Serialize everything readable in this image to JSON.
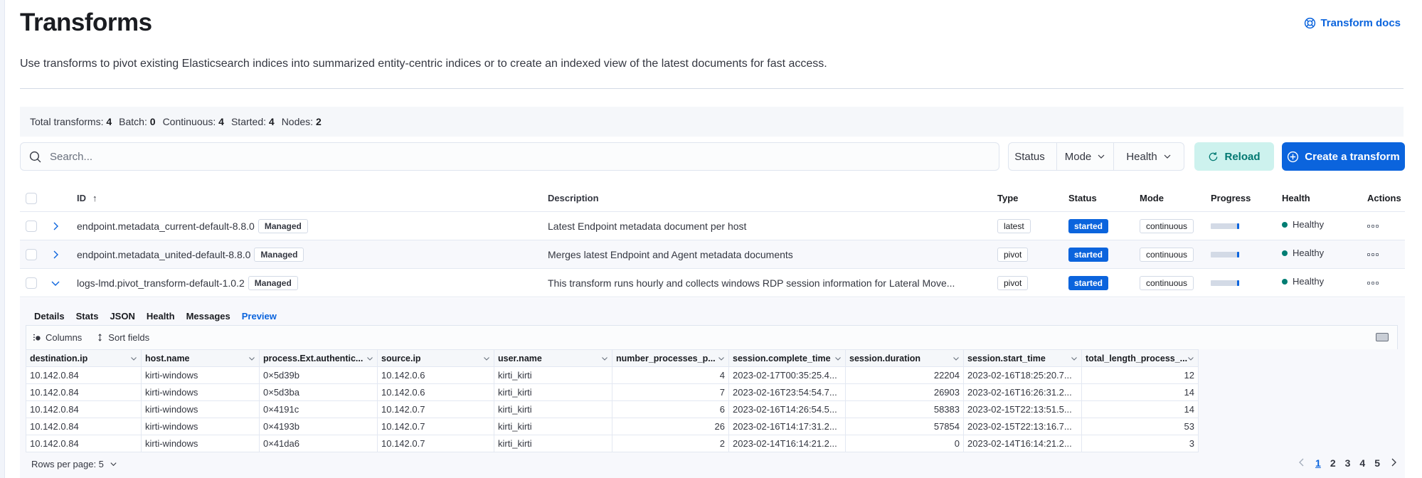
{
  "page": {
    "title": "Transforms",
    "description": "Use transforms to pivot existing Elasticsearch indices into summarized entity-centric indices or to create an indexed view of the latest documents for fast access.",
    "docs_link": "Transform docs"
  },
  "stats": [
    {
      "label": "Total transforms:",
      "value": "4"
    },
    {
      "label": "Batch:",
      "value": "0"
    },
    {
      "label": "Continuous:",
      "value": "4"
    },
    {
      "label": "Started:",
      "value": "4"
    },
    {
      "label": "Nodes:",
      "value": "2"
    }
  ],
  "search": {
    "placeholder": "Search...",
    "value": ""
  },
  "filters": {
    "status": "Status",
    "mode": "Mode",
    "health": "Health"
  },
  "buttons": {
    "reload": "Reload",
    "create": "Create a transform"
  },
  "colors": {
    "primary": "#0b64dd",
    "success": "#017d73",
    "reload_bg": "#cdf2ee"
  },
  "table": {
    "columns": {
      "id": "ID",
      "description": "Description",
      "type": "Type",
      "status": "Status",
      "mode": "Mode",
      "progress": "Progress",
      "health": "Health",
      "actions": "Actions"
    },
    "sort_indicator": "↑",
    "rows": [
      {
        "id": "endpoint.metadata_current-default-8.8.0",
        "badge": "Managed",
        "description": "Latest Endpoint metadata document per host",
        "type": "latest",
        "status": "started",
        "mode": "continuous",
        "progress_pct": 100,
        "health": "Healthy",
        "expanded": false
      },
      {
        "id": "endpoint.metadata_united-default-8.8.0",
        "badge": "Managed",
        "description": "Merges latest Endpoint and Agent metadata documents",
        "type": "pivot",
        "status": "started",
        "mode": "continuous",
        "progress_pct": 100,
        "health": "Healthy",
        "expanded": false
      },
      {
        "id": "logs-lmd.pivot_transform-default-1.0.2",
        "badge": "Managed",
        "description": "This transform runs hourly and collects windows RDP session information for Lateral Move...",
        "type": "pivot",
        "status": "started",
        "mode": "continuous",
        "progress_pct": 100,
        "health": "Healthy",
        "expanded": true
      }
    ]
  },
  "expanded_panel": {
    "tabs": [
      "Details",
      "Stats",
      "JSON",
      "Health",
      "Messages",
      "Preview"
    ],
    "active_tab": "Preview",
    "toolbar": {
      "columns": "Columns",
      "sort_fields": "Sort fields"
    },
    "grid": {
      "headers": [
        "destination.ip",
        "host.name",
        "process.Ext.authentic...",
        "source.ip",
        "user.name",
        "number_processes_p...",
        "session.complete_time",
        "session.duration",
        "session.start_time",
        "total_length_process_..."
      ],
      "rows": [
        [
          "10.142.0.84",
          "kirti-windows",
          "0×5d39b",
          "10.142.0.6",
          "kirti_kirti",
          "4",
          "2023-02-17T00:35:25.4...",
          "22204",
          "2023-02-16T18:25:20.7...",
          "12"
        ],
        [
          "10.142.0.84",
          "kirti-windows",
          "0×5d3ba",
          "10.142.0.6",
          "kirti_kirti",
          "7",
          "2023-02-16T23:54:54.7...",
          "26903",
          "2023-02-16T16:26:31.2...",
          "14"
        ],
        [
          "10.142.0.84",
          "kirti-windows",
          "0×4191c",
          "10.142.0.7",
          "kirti_kirti",
          "6",
          "2023-02-16T14:26:54.5...",
          "58383",
          "2023-02-15T22:13:51.5...",
          "14"
        ],
        [
          "10.142.0.84",
          "kirti-windows",
          "0×4193b",
          "10.142.0.7",
          "kirti_kirti",
          "26",
          "2023-02-16T14:17:31.2...",
          "57854",
          "2023-02-15T22:13:16.7...",
          "53"
        ],
        [
          "10.142.0.84",
          "kirti-windows",
          "0×41da6",
          "10.142.0.7",
          "kirti_kirti",
          "2",
          "2023-02-14T16:14:21.2...",
          "0",
          "2023-02-14T16:14:21.2...",
          "3"
        ]
      ]
    },
    "rows_per_page": "Rows per page: 5",
    "pagination": {
      "pages": [
        "1",
        "2",
        "3",
        "4",
        "5"
      ],
      "current": "1"
    }
  }
}
